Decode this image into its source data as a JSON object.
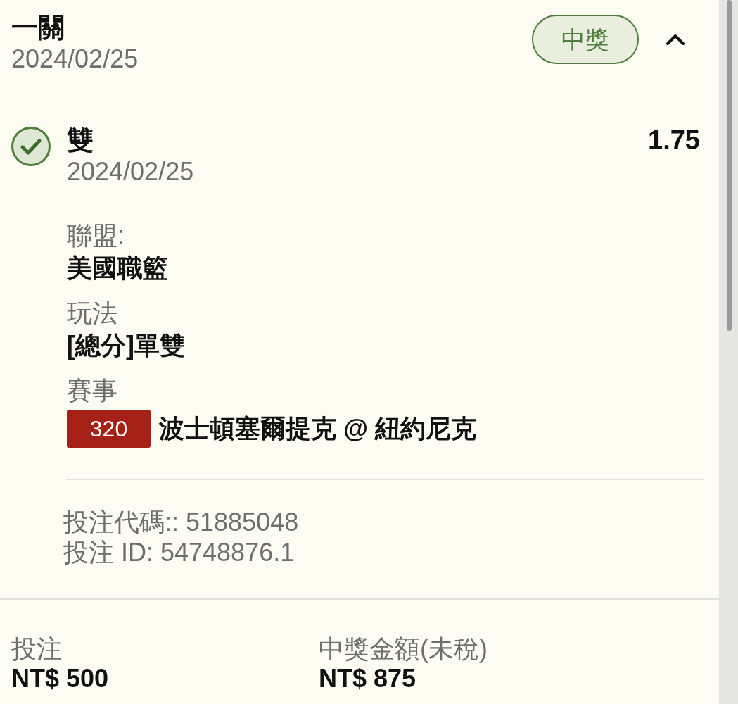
{
  "ticket": {
    "title": "一關",
    "date": "2024/02/25",
    "result_badge": "中獎",
    "expanded": true
  },
  "selections": [
    {
      "won": true,
      "pick": "雙",
      "date": "2024/02/25",
      "odds": "1.75",
      "fields": [
        {
          "kind": "text",
          "label": "聯盟:",
          "value": "美國職籃"
        },
        {
          "kind": "text",
          "label": "玩法",
          "value": "[總分]單雙"
        },
        {
          "kind": "match",
          "label": "賽事",
          "code": "320",
          "value": "波士頓塞爾提克 @ 紐約尼克"
        }
      ],
      "bet_code": "投注代碼:: 51885048",
      "bet_id": "投注 ID: 54748876.1"
    }
  ],
  "summary": [
    {
      "label": "投注",
      "value": "NT$ 500"
    },
    {
      "label": "中獎金額(未稅)",
      "value": "NT$ 875"
    }
  ]
}
